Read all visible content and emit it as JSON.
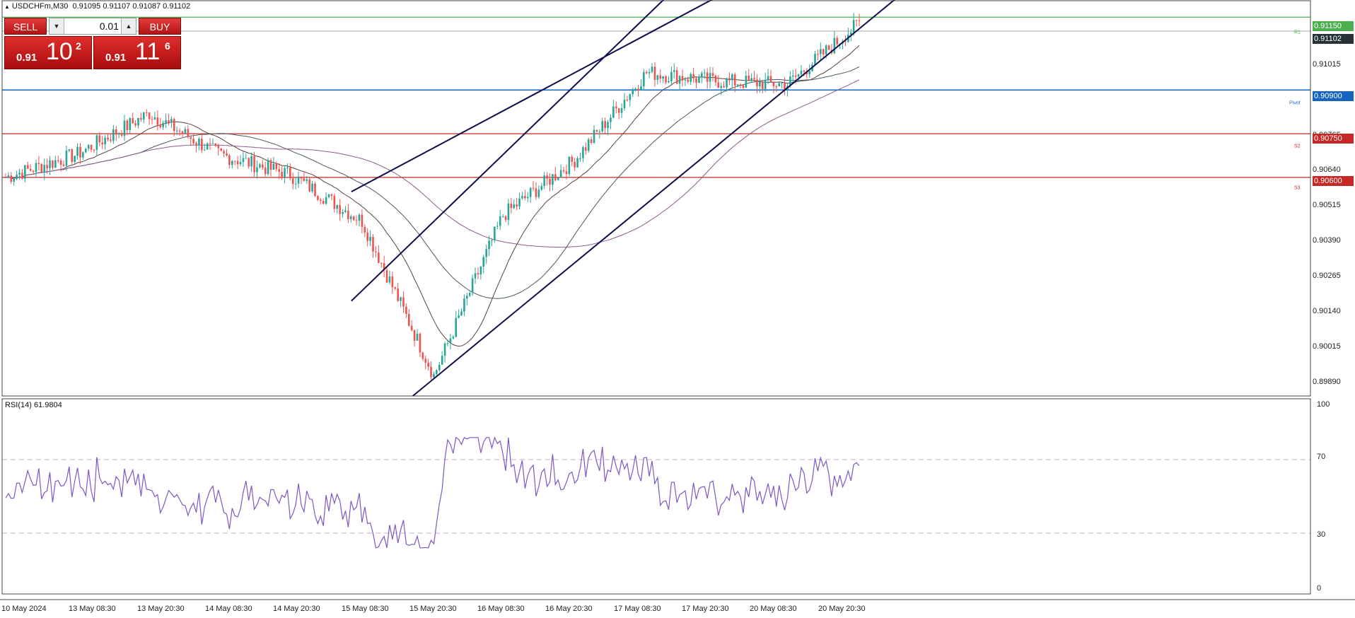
{
  "symbol": "USDCHFm,M30",
  "ohlc": "0.91095 0.91107 0.91087 0.91102",
  "trade_panel": {
    "sell_label": "SELL",
    "buy_label": "BUY",
    "lot": "0.01",
    "sell_small": "0.91",
    "sell_big": "10",
    "sell_sup": "2",
    "buy_small": "0.91",
    "buy_big": "11",
    "buy_sup": "6"
  },
  "price_axis": [
    "0.91015",
    "0.90765",
    "0.90640",
    "0.90515",
    "0.90390",
    "0.90265",
    "0.90140",
    "0.90015",
    "0.89890"
  ],
  "price_tags": {
    "r1": "0.91150",
    "current": "0.91102",
    "pivot": "0.90900",
    "s2": "0.90750",
    "s3": "0.90600"
  },
  "level_labels": {
    "r1": "R1",
    "pivot": "Pivot",
    "s2": "S2",
    "s3": "S3"
  },
  "rsi": {
    "label": "RSI(14) 61.9804",
    "axis": [
      "100",
      "70",
      "30",
      "0"
    ]
  },
  "time_axis": [
    "10 May 2024",
    "13 May 08:30",
    "13 May 20:30",
    "14 May 08:30",
    "14 May 20:30",
    "15 May 08:30",
    "15 May 20:30",
    "16 May 08:30",
    "16 May 20:30",
    "17 May 08:30",
    "17 May 20:30",
    "20 May 08:30",
    "20 May 20:30"
  ],
  "colors": {
    "bull": "#26a69a",
    "bear": "#ef5350",
    "r1_line": "#4caf50",
    "pivot_line": "#1565c0",
    "support_line": "#c62828",
    "channel": "#0d0d4d",
    "rsi_line": "#7e57c2"
  },
  "chart_data": {
    "type": "candlestick",
    "timeframe": "M30",
    "ylim": [
      0.8985,
      0.9117
    ],
    "levels": {
      "R1": 0.9115,
      "Pivot": 0.909,
      "S2": 0.9075,
      "S3": 0.906,
      "Current": 0.91102
    },
    "anchors": [
      {
        "t": "10 May",
        "price": 0.906
      },
      {
        "t": "13 May 08:30",
        "price": 0.9068
      },
      {
        "t": "13 May 20:30",
        "price": 0.9082
      },
      {
        "t": "14 May 08:30",
        "price": 0.9068
      },
      {
        "t": "14 May 20:30",
        "price": 0.9061
      },
      {
        "t": "15 May 08:30",
        "price": 0.9045
      },
      {
        "t": "15 May 20:30",
        "price": 0.8992
      },
      {
        "t": "16 May 08:30",
        "price": 0.9047
      },
      {
        "t": "16 May 20:30",
        "price": 0.9066
      },
      {
        "t": "17 May 08:30",
        "price": 0.9096
      },
      {
        "t": "17 May 20:30",
        "price": 0.9093
      },
      {
        "t": "20 May 08:30",
        "price": 0.9092
      },
      {
        "t": "20 May 20:30",
        "price": 0.9113
      }
    ],
    "rsi_ylim": [
      0,
      100
    ],
    "rsi_levels": [
      30,
      70
    ]
  }
}
